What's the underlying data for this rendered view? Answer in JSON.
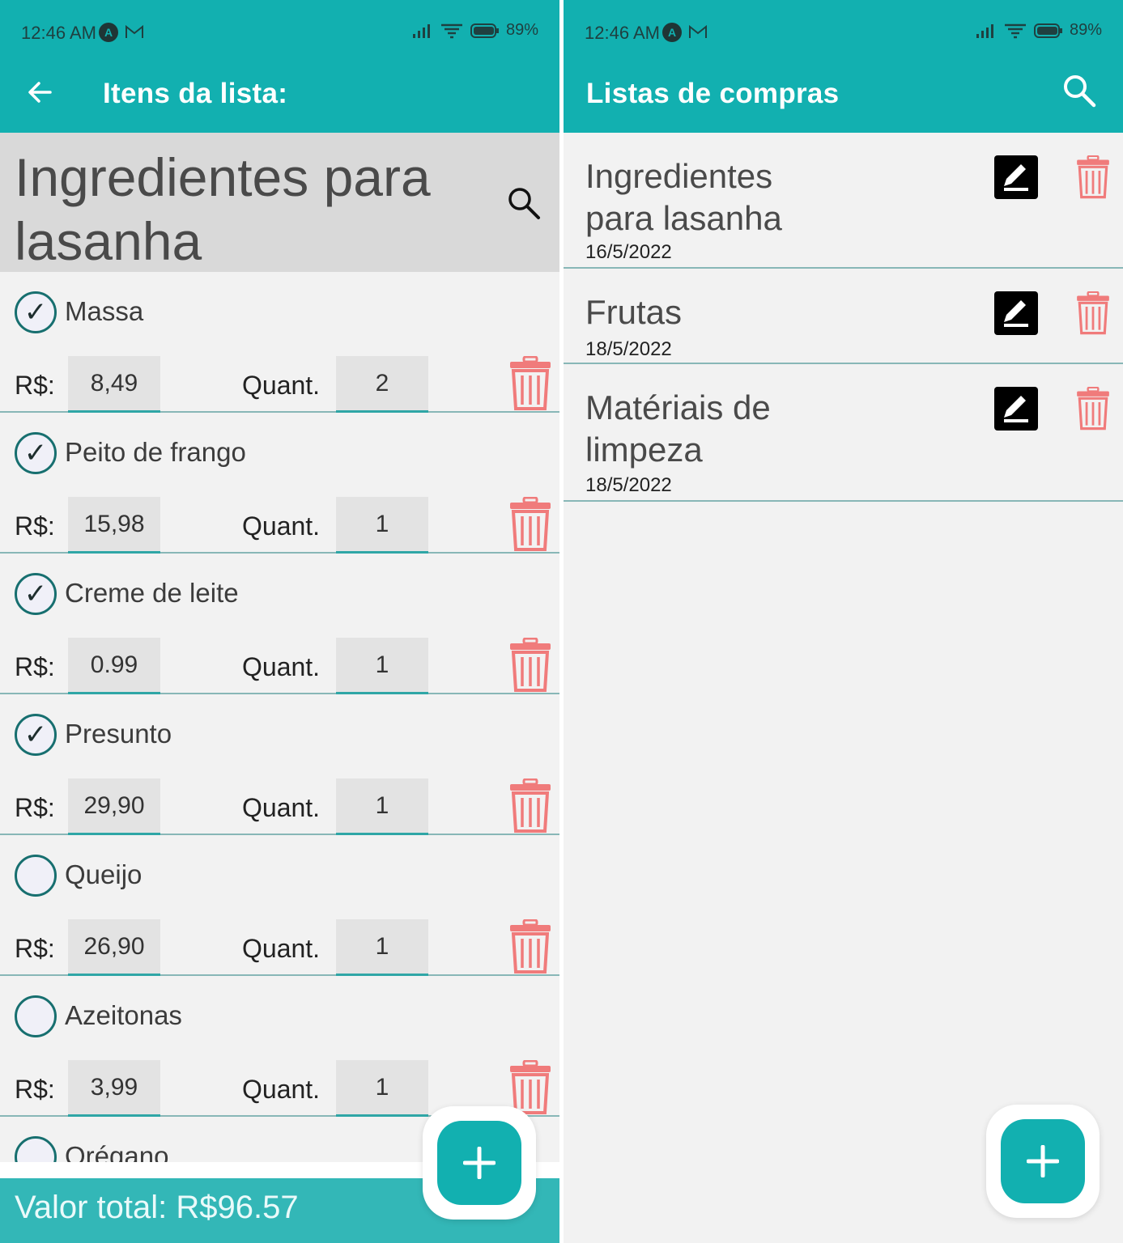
{
  "left_screen": {
    "status": {
      "time": "12:46 AM",
      "battery": "89%"
    },
    "appbar": {
      "title": "Itens da lista:"
    },
    "list_title": "Ingredientes para lasanha",
    "price_label": "R$:",
    "qty_label": "Quant.",
    "items": [
      {
        "name": "Massa",
        "checked": true,
        "price": "8,49",
        "qty": "2"
      },
      {
        "name": "Peito de frango",
        "checked": true,
        "price": "15,98",
        "qty": "1"
      },
      {
        "name": "Creme de leite",
        "checked": true,
        "price": "0.99",
        "qty": "1"
      },
      {
        "name": "Presunto",
        "checked": true,
        "price": "29,90",
        "qty": "1"
      },
      {
        "name": "Queijo",
        "checked": false,
        "price": "26,90",
        "qty": "1"
      },
      {
        "name": "Azeitonas",
        "checked": false,
        "price": "3,99",
        "qty": "1"
      },
      {
        "name": "Orégano",
        "checked": false,
        "price": "",
        "qty": ""
      }
    ],
    "total": "Valor total: R$96.57"
  },
  "right_screen": {
    "status": {
      "time": "12:46 AM",
      "battery": "89%"
    },
    "appbar": {
      "title": "Listas de compras"
    },
    "lists": [
      {
        "name": "Ingredientes para lasanha",
        "date": "16/5/2022"
      },
      {
        "name": "Frutas",
        "date": "18/5/2022"
      },
      {
        "name": "Matériais de limpeza",
        "date": "18/5/2022"
      }
    ]
  },
  "colors": {
    "primary": "#12b0b0",
    "trash": "#f07b7b",
    "divider": "#88b7b7"
  },
  "icons": [
    "back-arrow-icon",
    "search-icon",
    "check-icon",
    "trash-icon",
    "edit-icon",
    "plus-icon",
    "signal-icon",
    "wifi-icon",
    "battery-icon",
    "mail-icon"
  ]
}
